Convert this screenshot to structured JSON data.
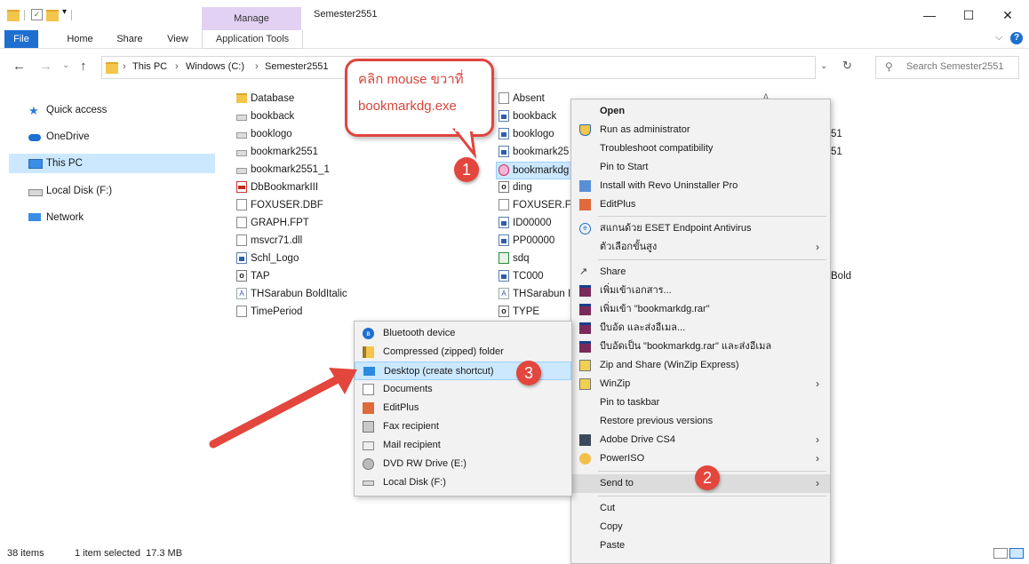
{
  "window": {
    "title": "Semester2551",
    "manage_label": "Manage",
    "minimize": "—",
    "maximize": "☐",
    "close": "✕",
    "help_icon": "?",
    "ribbon_collapse": "⌵"
  },
  "ribbon": {
    "tabs": [
      "File",
      "Home",
      "Share",
      "View",
      "Application Tools"
    ]
  },
  "address": {
    "breadcrumb": [
      "This PC",
      "Windows (C:)",
      "Semester2551"
    ],
    "search_placeholder": "Search Semester2551"
  },
  "sidebar": {
    "items": [
      {
        "label": "Quick access",
        "icon": "star-icon"
      },
      {
        "label": "OneDrive",
        "icon": "cloud-icon"
      },
      {
        "label": "This PC",
        "icon": "computer-icon",
        "selected": true
      },
      {
        "label": "Local Disk (F:)",
        "icon": "drive-icon"
      },
      {
        "label": "Network",
        "icon": "network-icon"
      }
    ]
  },
  "files": {
    "column1": [
      "Database",
      "bookback",
      "booklogo",
      "bookmark2551",
      "bookmark2551_1",
      "DbBookmarkIII",
      "FOXUSER.DBF",
      "GRAPH.FPT",
      "msvcr71.dll",
      "Schl_Logo",
      "TAP",
      "THSarabun BoldItalic",
      "TimePeriod"
    ],
    "column2": [
      "Absent",
      "bookback",
      "booklogo",
      "bookmark25",
      "bookmarkdg",
      "ding",
      "FOXUSER.FP",
      "ID00000",
      "PP00000",
      "sdq",
      "TC000",
      "THSarabun It",
      "TYPE"
    ],
    "column3_partial": [
      "A",
      "51",
      "51",
      "Bold"
    ]
  },
  "context_menu": {
    "items": [
      {
        "label": "Open",
        "bold": true
      },
      {
        "label": "Run as administrator",
        "icon": "shield-icon"
      },
      {
        "label": "Troubleshoot compatibility"
      },
      {
        "label": "Pin to Start"
      },
      {
        "label": "Install with Revo Uninstaller Pro",
        "icon": "revo-icon"
      },
      {
        "label": "EditPlus",
        "icon": "editplus-icon"
      },
      {
        "label": "สแกนด้วย ESET Endpoint Antivirus",
        "icon": "eset-icon"
      },
      {
        "label": "ตัวเลือกขั้นสูง",
        "submenu": true
      },
      {
        "label": "Share",
        "icon": "share-icon"
      },
      {
        "label": "เพิ่มเข้าเอกสาร...",
        "icon": "winrar-icon"
      },
      {
        "label": "เพิ่มเข้า \"bookmarkdg.rar\"",
        "icon": "winrar-icon"
      },
      {
        "label": "บีบอัด และส่งอีเมล...",
        "icon": "winrar-icon"
      },
      {
        "label": "บีบอัดเป็น \"bookmarkdg.rar\" และส่งอีเมล",
        "icon": "winrar-icon"
      },
      {
        "label": "Zip and Share (WinZip Express)",
        "icon": "winzip-icon"
      },
      {
        "label": "WinZip",
        "icon": "winzip-icon",
        "submenu": true
      },
      {
        "label": "Pin to taskbar"
      },
      {
        "label": "Restore previous versions"
      },
      {
        "label": "Adobe Drive CS4",
        "icon": "adobe-drive-icon",
        "submenu": true
      },
      {
        "label": "PowerISO",
        "icon": "poweriso-icon",
        "submenu": true
      },
      {
        "label": "Send to",
        "submenu": true,
        "highlighted": true
      },
      {
        "label": "Cut"
      },
      {
        "label": "Copy"
      },
      {
        "label": "Paste"
      }
    ]
  },
  "send_to_menu": {
    "items": [
      {
        "label": "Bluetooth device",
        "icon": "bluetooth-icon"
      },
      {
        "label": "Compressed (zipped) folder",
        "icon": "zip-folder-icon"
      },
      {
        "label": "Desktop (create shortcut)",
        "icon": "desktop-icon",
        "highlighted": true
      },
      {
        "label": "Documents",
        "icon": "documents-icon"
      },
      {
        "label": "EditPlus",
        "icon": "editplus-icon"
      },
      {
        "label": "Fax recipient",
        "icon": "fax-icon"
      },
      {
        "label": "Mail recipient",
        "icon": "mail-icon"
      },
      {
        "label": "DVD RW Drive (E:)",
        "icon": "dvd-icon"
      },
      {
        "label": "Local Disk (F:)",
        "icon": "drive-icon"
      }
    ]
  },
  "annotations": {
    "callout_line1": "คลิก mouse ขวาที่",
    "callout_line2": "bookmarkdg.exe",
    "badge1": "1",
    "badge2": "2",
    "badge3": "3"
  },
  "status": {
    "items_count": "38 items",
    "selection": "1 item selected  17.3 MB"
  },
  "colors": {
    "accent": "#1e6fd0",
    "manage_tab": "#e3d1f3",
    "annotation_red": "#e2463c",
    "selection": "#cce8ff"
  }
}
